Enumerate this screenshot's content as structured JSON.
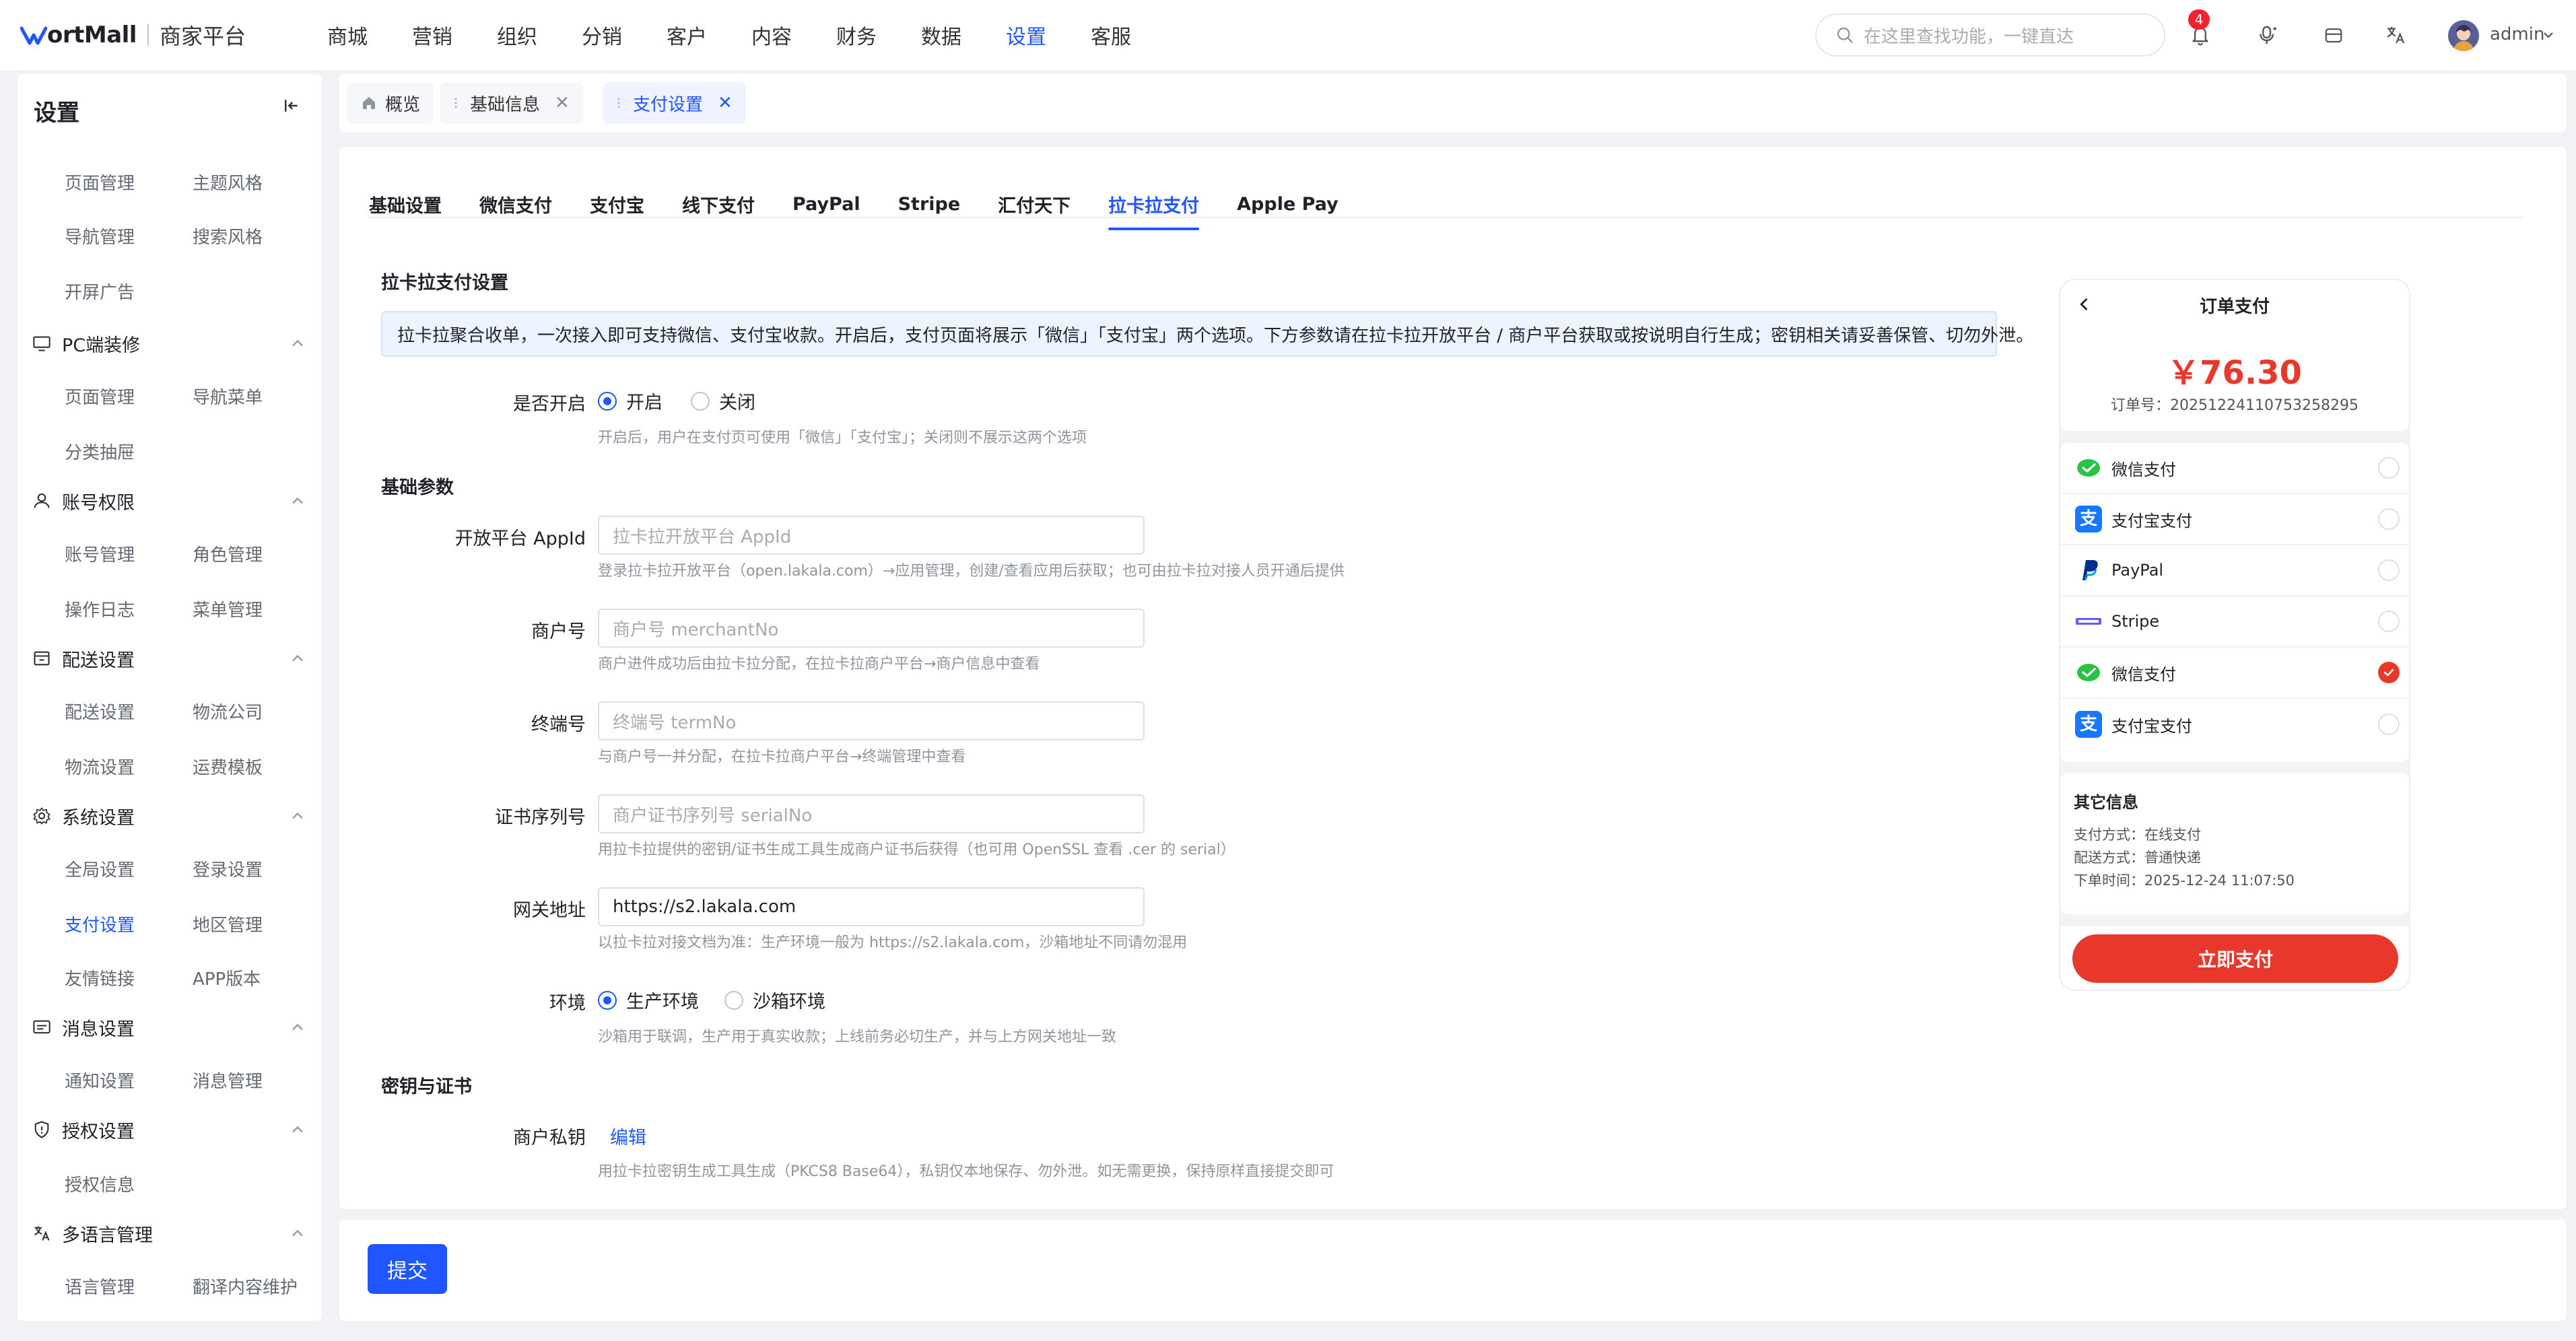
{
  "brand": {
    "name": "ortMall",
    "subtitle": "商家平台"
  },
  "topnav": [
    "商城",
    "营销",
    "组织",
    "分销",
    "客户",
    "内容",
    "财务",
    "数据",
    "设置",
    "客服"
  ],
  "topnav_active": "设置",
  "search": {
    "placeholder": "在这里查找功能，一键直达"
  },
  "notifications": {
    "count": "4"
  },
  "user": {
    "name": "admin"
  },
  "sidebar": {
    "title": "设置",
    "groups": [
      {
        "label": "PC端装修",
        "items": [
          "页面管理",
          "导航菜单",
          "分类抽屉"
        ]
      },
      {
        "label": "账号权限",
        "items": [
          "账号管理",
          "角色管理",
          "操作日志",
          "菜单管理"
        ]
      },
      {
        "label": "配送设置",
        "items": [
          "配送设置",
          "物流公司",
          "物流设置",
          "运费模板"
        ]
      },
      {
        "label": "系统设置",
        "items": [
          "全局设置",
          "登录设置",
          "支付设置",
          "地区管理",
          "友情链接",
          "APP版本"
        ]
      },
      {
        "label": "消息设置",
        "items": [
          "通知设置",
          "消息管理"
        ]
      },
      {
        "label": "授权设置",
        "items": [
          "授权信息"
        ]
      },
      {
        "label": "多语言管理",
        "items": [
          "语言管理",
          "翻译内容维护"
        ]
      }
    ],
    "top_items": [
      "页面管理",
      "主题风格",
      "导航管理",
      "搜索风格",
      "开屏广告"
    ],
    "active_item": "支付设置"
  },
  "page_tabs": [
    {
      "label": "概览"
    },
    {
      "label": "基础信息"
    },
    {
      "label": "支付设置"
    }
  ],
  "sub_tabs": [
    "基础设置",
    "微信支付",
    "支付宝",
    "线下支付",
    "PayPal",
    "Stripe",
    "汇付天下",
    "拉卡拉支付",
    "Apple Pay"
  ],
  "sub_tab_active": "拉卡拉支付",
  "form": {
    "section_title": "拉卡拉支付设置",
    "info": "拉卡拉聚合收单，一次接入即可支持微信、支付宝收款。开启后，支付页面将展示「微信」「支付宝」两个选项。下方参数请在拉卡拉开放平台 / 商户平台获取或按说明自行生成；密钥相关请妥善保管、切勿外泄。",
    "enable": {
      "label": "是否开启",
      "on": "开启",
      "off": "关闭",
      "value": "开启",
      "hint": "开启后，用户在支付页可使用「微信」「支付宝」；关闭则不展示这两个选项"
    },
    "basic_title": "基础参数",
    "appid": {
      "label": "开放平台 AppId",
      "placeholder": "拉卡拉开放平台 AppId",
      "hint": "登录拉卡拉开放平台（open.lakala.com）→应用管理，创建/查看应用后获取；也可由拉卡拉对接人员开通后提供"
    },
    "merchant": {
      "label": "商户号",
      "placeholder": "商户号 merchantNo",
      "hint": "商户进件成功后由拉卡拉分配，在拉卡拉商户平台→商户信息中查看"
    },
    "term": {
      "label": "终端号",
      "placeholder": "终端号 termNo",
      "hint": "与商户号一并分配，在拉卡拉商户平台→终端管理中查看"
    },
    "serial": {
      "label": "证书序列号",
      "placeholder": "商户证书序列号 serialNo",
      "hint": "用拉卡拉提供的密钥/证书生成工具生成商户证书后获得（也可用 OpenSSL 查看 .cer 的 serial）"
    },
    "gateway": {
      "label": "网关地址",
      "value": "https://s2.lakala.com",
      "hint": "以拉卡拉对接文档为准：生产环境一般为 https://s2.lakala.com，沙箱地址不同请勿混用"
    },
    "env": {
      "label": "环境",
      "prod": "生产环境",
      "sandbox": "沙箱环境",
      "value": "生产环境",
      "hint": "沙箱用于联调，生产用于真实收款；上线前务必切生产，并与上方网关地址一致"
    },
    "key_title": "密钥与证书",
    "privkey": {
      "label": "商户私钥",
      "edit": "编辑",
      "hint": "用拉卡拉密钥生成工具生成（PKCS8 Base64），私钥仅本地保存、勿外泄。如无需更换，保持原样直接提交即可"
    }
  },
  "preview": {
    "title": "订单支付",
    "amount": "￥76.30",
    "order_no": "订单号：2025122411075325829 5",
    "methods": [
      {
        "name": "微信支付",
        "icon": "wechat-icon",
        "checked": false
      },
      {
        "name": "支付宝支付",
        "icon": "alipay-icon",
        "checked": false
      },
      {
        "name": "PayPal",
        "icon": "paypal-icon",
        "checked": false
      },
      {
        "name": "Stripe",
        "icon": "stripe-icon",
        "checked": false
      },
      {
        "name": "微信支付",
        "icon": "wechat-icon",
        "checked": true
      },
      {
        "name": "支付宝支付",
        "icon": "alipay-icon",
        "checked": false
      }
    ],
    "other_title": "其它信息",
    "pay_type": "支付方式：在线支付",
    "delivery": "配送方式：普通快递",
    "order_time": "下单时间：2025-12-24 11:07:50",
    "pay_button": "立即支付"
  },
  "submit_label": "提交",
  "colors": {
    "primary": "#1f56ff",
    "danger": "#e8372b"
  }
}
